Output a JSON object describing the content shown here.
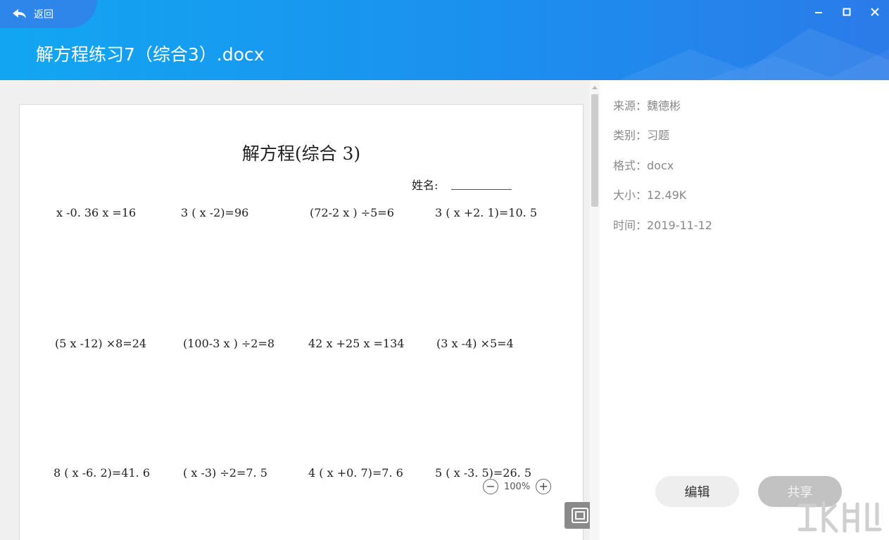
{
  "header": {
    "back_label": "返回",
    "title": "解方程练习7（综合3）.docx"
  },
  "document": {
    "heading": "解方程(综合 3)",
    "name_label": "姓名:",
    "equations": [
      [
        "x -0. 36 x =16",
        "3 ( x -2)=96",
        "(72-2 x ) ÷5=6",
        "3 ( x +2. 1)=10. 5"
      ],
      [
        "(5 x -12) ×8=24",
        "(100-3 x ) ÷2=8",
        "42 x +25 x =134",
        "(3 x -4)  ×5=4"
      ],
      [
        "8 ( x -6. 2)=41. 6",
        "( x -3) ÷2=7. 5",
        "4 ( x +0. 7)=7. 6",
        "5 ( x -3. 5)=26. 5"
      ]
    ]
  },
  "zoom": {
    "level": "100%",
    "minus": "−",
    "plus": "+"
  },
  "info": {
    "source": "来源：魏德彬",
    "category": "类别：习题",
    "format": "格式：docx",
    "size": "大小：12.49K",
    "time": "时间：2019-11-12"
  },
  "actions": {
    "edit": "编辑",
    "share": "共享"
  },
  "icons": {
    "back": "back-arrow-icon",
    "minimize": "minimize-icon",
    "maximize": "maximize-icon",
    "close": "close-icon",
    "fit": "fit-screen-icon"
  },
  "colors": {
    "header_start": "#12a6f2",
    "header_end": "#2b7be9",
    "back_button": "#2f86ea",
    "viewer_bg": "#f0f0f0",
    "share_disabled": "#c2c2c2"
  }
}
